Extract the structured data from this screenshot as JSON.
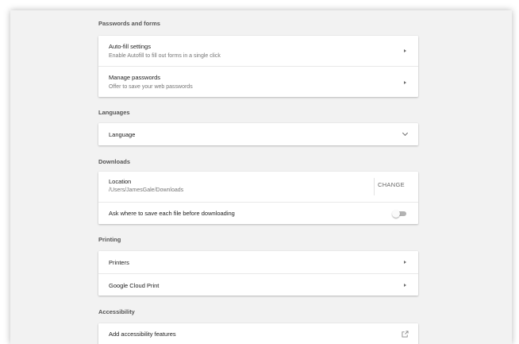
{
  "sections": {
    "passwords": {
      "title": "Passwords and forms",
      "autofill": {
        "label": "Auto-fill settings",
        "description": "Enable Autofill to fill out forms in a single click"
      },
      "manage_passwords": {
        "label": "Manage passwords",
        "description": "Offer to save your web passwords"
      }
    },
    "languages": {
      "title": "Languages",
      "language": {
        "label": "Language"
      }
    },
    "downloads": {
      "title": "Downloads",
      "location": {
        "label": "Location",
        "path": "/Users/JamesGale/Downloads",
        "button": "CHANGE"
      },
      "ask_where": {
        "label": "Ask where to save each file before downloading",
        "enabled": false
      }
    },
    "printing": {
      "title": "Printing",
      "printers": {
        "label": "Printers"
      },
      "cloud_print": {
        "label": "Google Cloud Print"
      }
    },
    "accessibility": {
      "title": "Accessibility",
      "add_features": {
        "label": "Add accessibility features"
      }
    }
  },
  "icons": {
    "row_arrow": "chevron-right-icon",
    "expand": "chevron-down-icon",
    "external": "external-link-icon"
  },
  "colors": {
    "page_background": "#f2f2f2",
    "card_background": "#ffffff",
    "primary_text": "#202020",
    "secondary_text": "#757575",
    "toggle_off_track": "#b3b3b3"
  }
}
